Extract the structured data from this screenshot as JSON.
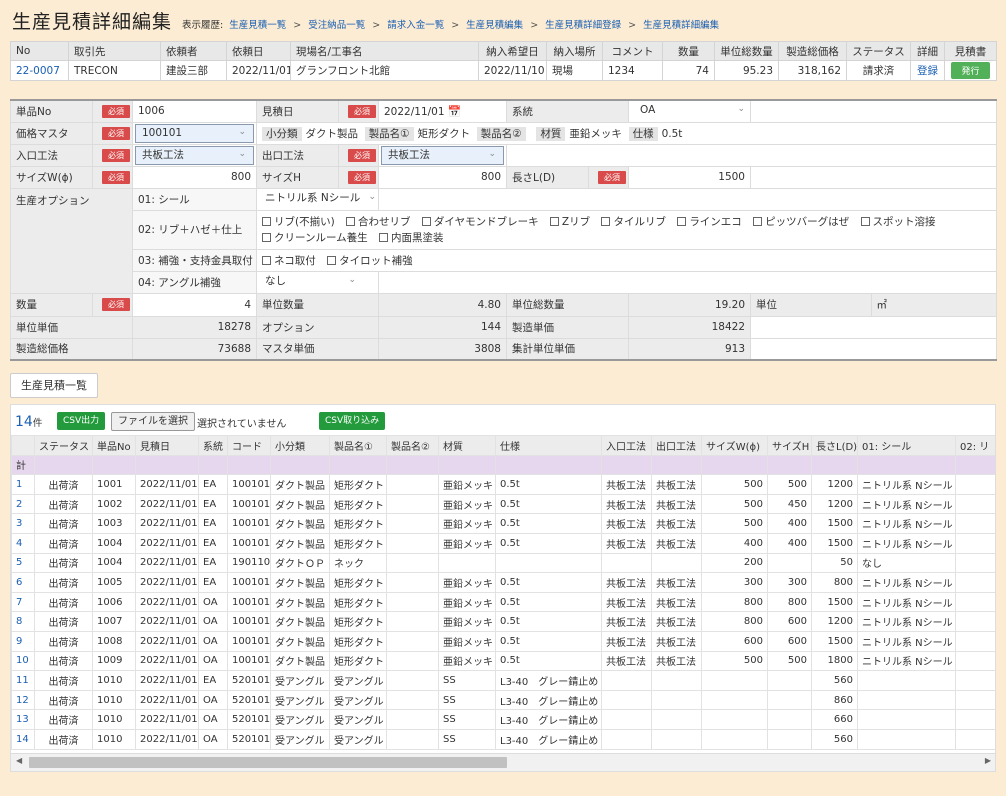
{
  "page": {
    "title": "生産見積詳細編集",
    "breadcrumb_label": "表示履歴:",
    "breadcrumbs": [
      "生産見積一覧",
      "受注納品一覧",
      "請求入金一覧",
      "生産見積編集",
      "生産見積詳細登録",
      "生産見積詳細編集"
    ]
  },
  "summary": {
    "headers": [
      "No",
      "取引先",
      "依頼者",
      "依頼日",
      "現場名/工事名",
      "納入希望日",
      "納入場所",
      "コメント",
      "数量",
      "単位総数量",
      "製造総価格",
      "ステータス",
      "詳細",
      "見積書"
    ],
    "row": {
      "no": "22-0007",
      "client": "TRECON",
      "requester": "建設三部",
      "req_date": "2022/11/01",
      "site": "グランフロント北館",
      "delivery_date": "2022/11/10",
      "place": "現場",
      "comment": "1234",
      "qty": "74",
      "unit_total": "95.23",
      "total_price": "318,162",
      "status": "請求済",
      "detail": "登録",
      "issue": "発行"
    }
  },
  "form": {
    "required": "必須",
    "item_no_label": "単品No",
    "item_no": "1006",
    "est_date_label": "見積日",
    "est_date": "2022/11/01",
    "system_label": "系統",
    "system": "OA",
    "price_master_label": "価格マスタ",
    "price_master": "100101",
    "subcat_tag": "小分類",
    "subcat": "ダクト製品",
    "prod1_tag": "製品名①",
    "prod1": "矩形ダクト",
    "prod2_tag": "製品名②",
    "material_tag": "材質",
    "material": "亜鉛メッキ",
    "spec_tag": "仕様",
    "spec": "0.5t",
    "in_method_label": "入口工法",
    "in_method": "共板工法",
    "out_method_label": "出口工法",
    "out_method": "共板工法",
    "size_w_label": "サイズW(ϕ)",
    "size_w": "800",
    "size_h_label": "サイズH",
    "size_h": "800",
    "len_label": "長さL(D)",
    "len": "1500",
    "opt_label": "生産オプション",
    "opt1_label": "01: シール",
    "opt1": "ニトリル系 Nシール",
    "opt2_label": "02: リブ＋ハゼ＋仕上",
    "opt2_items": [
      "リブ(不揃い)",
      "合わせリブ",
      "ダイヤモンドブレーキ",
      "Zリブ",
      "タイルリブ",
      "ラインエコ",
      "ピッツバーグはぜ",
      "スポット溶接",
      "クリーンルーム養生",
      "内面黒塗装"
    ],
    "opt3_label": "03: 補強・支持金具取付",
    "opt3_items": [
      "ネコ取付",
      "タイロット補強"
    ],
    "opt4_label": "04: アングル補強",
    "opt4": "なし",
    "qty_label": "数量",
    "qty": "4",
    "unit_qty_label": "単位数量",
    "unit_qty": "4.80",
    "unit_total_label": "単位総数量",
    "unit_total": "19.20",
    "unit_label": "単位",
    "unit": "㎡",
    "unit_price_label": "単位単価",
    "unit_price": "18278",
    "option_label": "オプション",
    "option": "144",
    "mfg_price_label": "製造単価",
    "mfg_price": "18422",
    "mfg_total_label": "製造総価格",
    "mfg_total": "73688",
    "master_price_label": "マスタ単価",
    "master_price": "3808",
    "agg_unit_price_label": "集計単位単価",
    "agg_unit_price": "913"
  },
  "list": {
    "button": "生産見積一覧",
    "count": "14",
    "count_unit": "件",
    "csv_out": "CSV出力",
    "file_button": "ファイルを選択",
    "file_status": "選択されていません",
    "csv_in": "CSV取り込み",
    "total_label": "計",
    "headers": [
      "",
      "ステータス",
      "単品No",
      "見積日",
      "系統",
      "コード",
      "小分類",
      "製品名①",
      "製品名②",
      "材質",
      "仕様",
      "入口工法",
      "出口工法",
      "サイズW(ϕ)",
      "サイズH",
      "長さL(D)",
      "01: シール",
      "02: リ"
    ],
    "rows": [
      [
        "1",
        "出荷済",
        "1001",
        "2022/11/01",
        "EA",
        "100101",
        "ダクト製品",
        "矩形ダクト",
        "",
        "亜鉛メッキ",
        "0.5t",
        "共板工法",
        "共板工法",
        "500",
        "500",
        "1200",
        "ニトリル系 Nシール",
        ""
      ],
      [
        "2",
        "出荷済",
        "1002",
        "2022/11/01",
        "EA",
        "100101",
        "ダクト製品",
        "矩形ダクト",
        "",
        "亜鉛メッキ",
        "0.5t",
        "共板工法",
        "共板工法",
        "500",
        "450",
        "1200",
        "ニトリル系 Nシール",
        ""
      ],
      [
        "3",
        "出荷済",
        "1003",
        "2022/11/01",
        "EA",
        "100101",
        "ダクト製品",
        "矩形ダクト",
        "",
        "亜鉛メッキ",
        "0.5t",
        "共板工法",
        "共板工法",
        "500",
        "400",
        "1500",
        "ニトリル系 Nシール",
        ""
      ],
      [
        "4",
        "出荷済",
        "1004",
        "2022/11/01",
        "EA",
        "100101",
        "ダクト製品",
        "矩形ダクト",
        "",
        "亜鉛メッキ",
        "0.5t",
        "共板工法",
        "共板工法",
        "400",
        "400",
        "1500",
        "ニトリル系 Nシール",
        ""
      ],
      [
        "5",
        "出荷済",
        "1004",
        "2022/11/01",
        "EA",
        "190110",
        "ダクトＯＰ",
        "ネック",
        "",
        "",
        "",
        "",
        "",
        "200",
        "",
        "50",
        "なし",
        ""
      ],
      [
        "6",
        "出荷済",
        "1005",
        "2022/11/01",
        "EA",
        "100101",
        "ダクト製品",
        "矩形ダクト",
        "",
        "亜鉛メッキ",
        "0.5t",
        "共板工法",
        "共板工法",
        "300",
        "300",
        "800",
        "ニトリル系 Nシール",
        ""
      ],
      [
        "7",
        "出荷済",
        "1006",
        "2022/11/01",
        "OA",
        "100101",
        "ダクト製品",
        "矩形ダクト",
        "",
        "亜鉛メッキ",
        "0.5t",
        "共板工法",
        "共板工法",
        "800",
        "800",
        "1500",
        "ニトリル系 Nシール",
        ""
      ],
      [
        "8",
        "出荷済",
        "1007",
        "2022/11/01",
        "OA",
        "100101",
        "ダクト製品",
        "矩形ダクト",
        "",
        "亜鉛メッキ",
        "0.5t",
        "共板工法",
        "共板工法",
        "800",
        "600",
        "1200",
        "ニトリル系 Nシール",
        ""
      ],
      [
        "9",
        "出荷済",
        "1008",
        "2022/11/01",
        "OA",
        "100101",
        "ダクト製品",
        "矩形ダクト",
        "",
        "亜鉛メッキ",
        "0.5t",
        "共板工法",
        "共板工法",
        "600",
        "600",
        "1500",
        "ニトリル系 Nシール",
        ""
      ],
      [
        "10",
        "出荷済",
        "1009",
        "2022/11/01",
        "OA",
        "100101",
        "ダクト製品",
        "矩形ダクト",
        "",
        "亜鉛メッキ",
        "0.5t",
        "共板工法",
        "共板工法",
        "500",
        "500",
        "1800",
        "ニトリル系 Nシール",
        ""
      ],
      [
        "11",
        "出荷済",
        "1010",
        "2022/11/01",
        "EA",
        "520101",
        "受アングル",
        "受アングル",
        "",
        "SS",
        "L3-40　グレー錆止め",
        "",
        "",
        "",
        "",
        "560",
        "",
        ""
      ],
      [
        "12",
        "出荷済",
        "1010",
        "2022/11/01",
        "OA",
        "520101",
        "受アングル",
        "受アングル",
        "",
        "SS",
        "L3-40　グレー錆止め",
        "",
        "",
        "",
        "",
        "860",
        "",
        ""
      ],
      [
        "13",
        "出荷済",
        "1010",
        "2022/11/01",
        "OA",
        "520101",
        "受アングル",
        "受アングル",
        "",
        "SS",
        "L3-40　グレー錆止め",
        "",
        "",
        "",
        "",
        "660",
        "",
        ""
      ],
      [
        "14",
        "出荷済",
        "1010",
        "2022/11/01",
        "OA",
        "520101",
        "受アングル",
        "受アングル",
        "",
        "SS",
        "L3-40　グレー錆止め",
        "",
        "",
        "",
        "",
        "560",
        "",
        ""
      ]
    ]
  }
}
